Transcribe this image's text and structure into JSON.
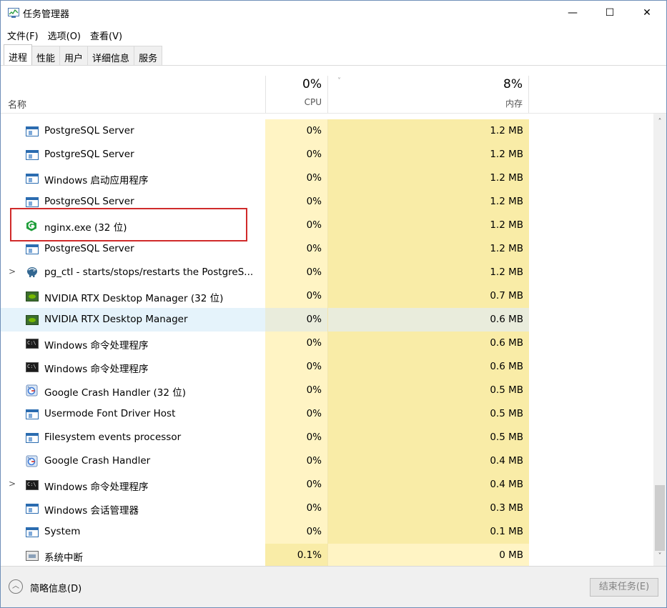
{
  "window": {
    "title": "任务管理器",
    "controls": {
      "minimize": "—",
      "maximize": "☐",
      "close": "✕"
    }
  },
  "menu": [
    "文件(F)",
    "选项(O)",
    "查看(V)"
  ],
  "tabs": [
    "进程",
    "性能",
    "用户",
    "详细信息",
    "服务"
  ],
  "header": {
    "name": "名称",
    "cpu_pct": "0%",
    "cpu_label": "CPU",
    "mem_pct": "8%",
    "mem_label": "内存",
    "sort_caret": "˅"
  },
  "processes": [
    {
      "name": "PostgreSQL Server",
      "cpu": "0%",
      "mem": "1.2 MB",
      "icon": "app-window-icon",
      "expandable": false
    },
    {
      "name": "PostgreSQL Server",
      "cpu": "0%",
      "mem": "1.2 MB",
      "icon": "app-window-icon",
      "expandable": false
    },
    {
      "name": "Windows 启动应用程序",
      "cpu": "0%",
      "mem": "1.2 MB",
      "icon": "app-window-icon",
      "expandable": false
    },
    {
      "name": "PostgreSQL Server",
      "cpu": "0%",
      "mem": "1.2 MB",
      "icon": "app-window-icon",
      "expandable": false
    },
    {
      "name": "nginx.exe (32 位)",
      "cpu": "0%",
      "mem": "1.2 MB",
      "icon": "nginx-icon",
      "expandable": false
    },
    {
      "name": "PostgreSQL Server",
      "cpu": "0%",
      "mem": "1.2 MB",
      "icon": "app-window-icon",
      "expandable": false
    },
    {
      "name": "pg_ctl - starts/stops/restarts the PostgreS...",
      "cpu": "0%",
      "mem": "1.2 MB",
      "icon": "postgresql-elephant-icon",
      "expandable": true
    },
    {
      "name": "NVIDIA RTX Desktop Manager (32 位)",
      "cpu": "0%",
      "mem": "0.7 MB",
      "icon": "nvidia-icon",
      "expandable": false
    },
    {
      "name": "NVIDIA RTX Desktop Manager",
      "cpu": "0%",
      "mem": "0.6 MB",
      "icon": "nvidia-icon",
      "expandable": false,
      "selected": true
    },
    {
      "name": "Windows 命令处理程序",
      "cpu": "0%",
      "mem": "0.6 MB",
      "icon": "command-prompt-icon",
      "expandable": false
    },
    {
      "name": "Windows 命令处理程序",
      "cpu": "0%",
      "mem": "0.6 MB",
      "icon": "command-prompt-icon",
      "expandable": false
    },
    {
      "name": "Google Crash Handler (32 位)",
      "cpu": "0%",
      "mem": "0.5 MB",
      "icon": "google-crash-handler-icon",
      "expandable": false
    },
    {
      "name": "Usermode Font Driver Host",
      "cpu": "0%",
      "mem": "0.5 MB",
      "icon": "app-window-icon",
      "expandable": false
    },
    {
      "name": "Filesystem events processor",
      "cpu": "0%",
      "mem": "0.5 MB",
      "icon": "app-window-icon",
      "expandable": false
    },
    {
      "name": "Google Crash Handler",
      "cpu": "0%",
      "mem": "0.4 MB",
      "icon": "google-crash-handler-icon",
      "expandable": false
    },
    {
      "name": "Windows 命令处理程序",
      "cpu": "0%",
      "mem": "0.4 MB",
      "icon": "command-prompt-icon",
      "expandable": true
    },
    {
      "name": "Windows 会话管理器",
      "cpu": "0%",
      "mem": "0.3 MB",
      "icon": "app-window-icon",
      "expandable": false
    },
    {
      "name": "System",
      "cpu": "0%",
      "mem": "0.1 MB",
      "icon": "app-window-icon",
      "expandable": false
    },
    {
      "name": "系统中断",
      "cpu": "0.1%",
      "mem": "0 MB",
      "icon": "system-interrupt-icon",
      "expandable": false,
      "cpu_hot": true
    }
  ],
  "colors": {
    "cpu_column": "#fff4c4",
    "mem_column": "#f9eca7",
    "selection": "#e5f3fb",
    "highlight_box": "#d02a2a"
  },
  "footer": {
    "toggle_icon": "︿",
    "fewer_details": "简略信息(D)",
    "end_task": "结束任务(E)"
  },
  "scrollbar": {
    "up": "˄",
    "down": "˅"
  }
}
